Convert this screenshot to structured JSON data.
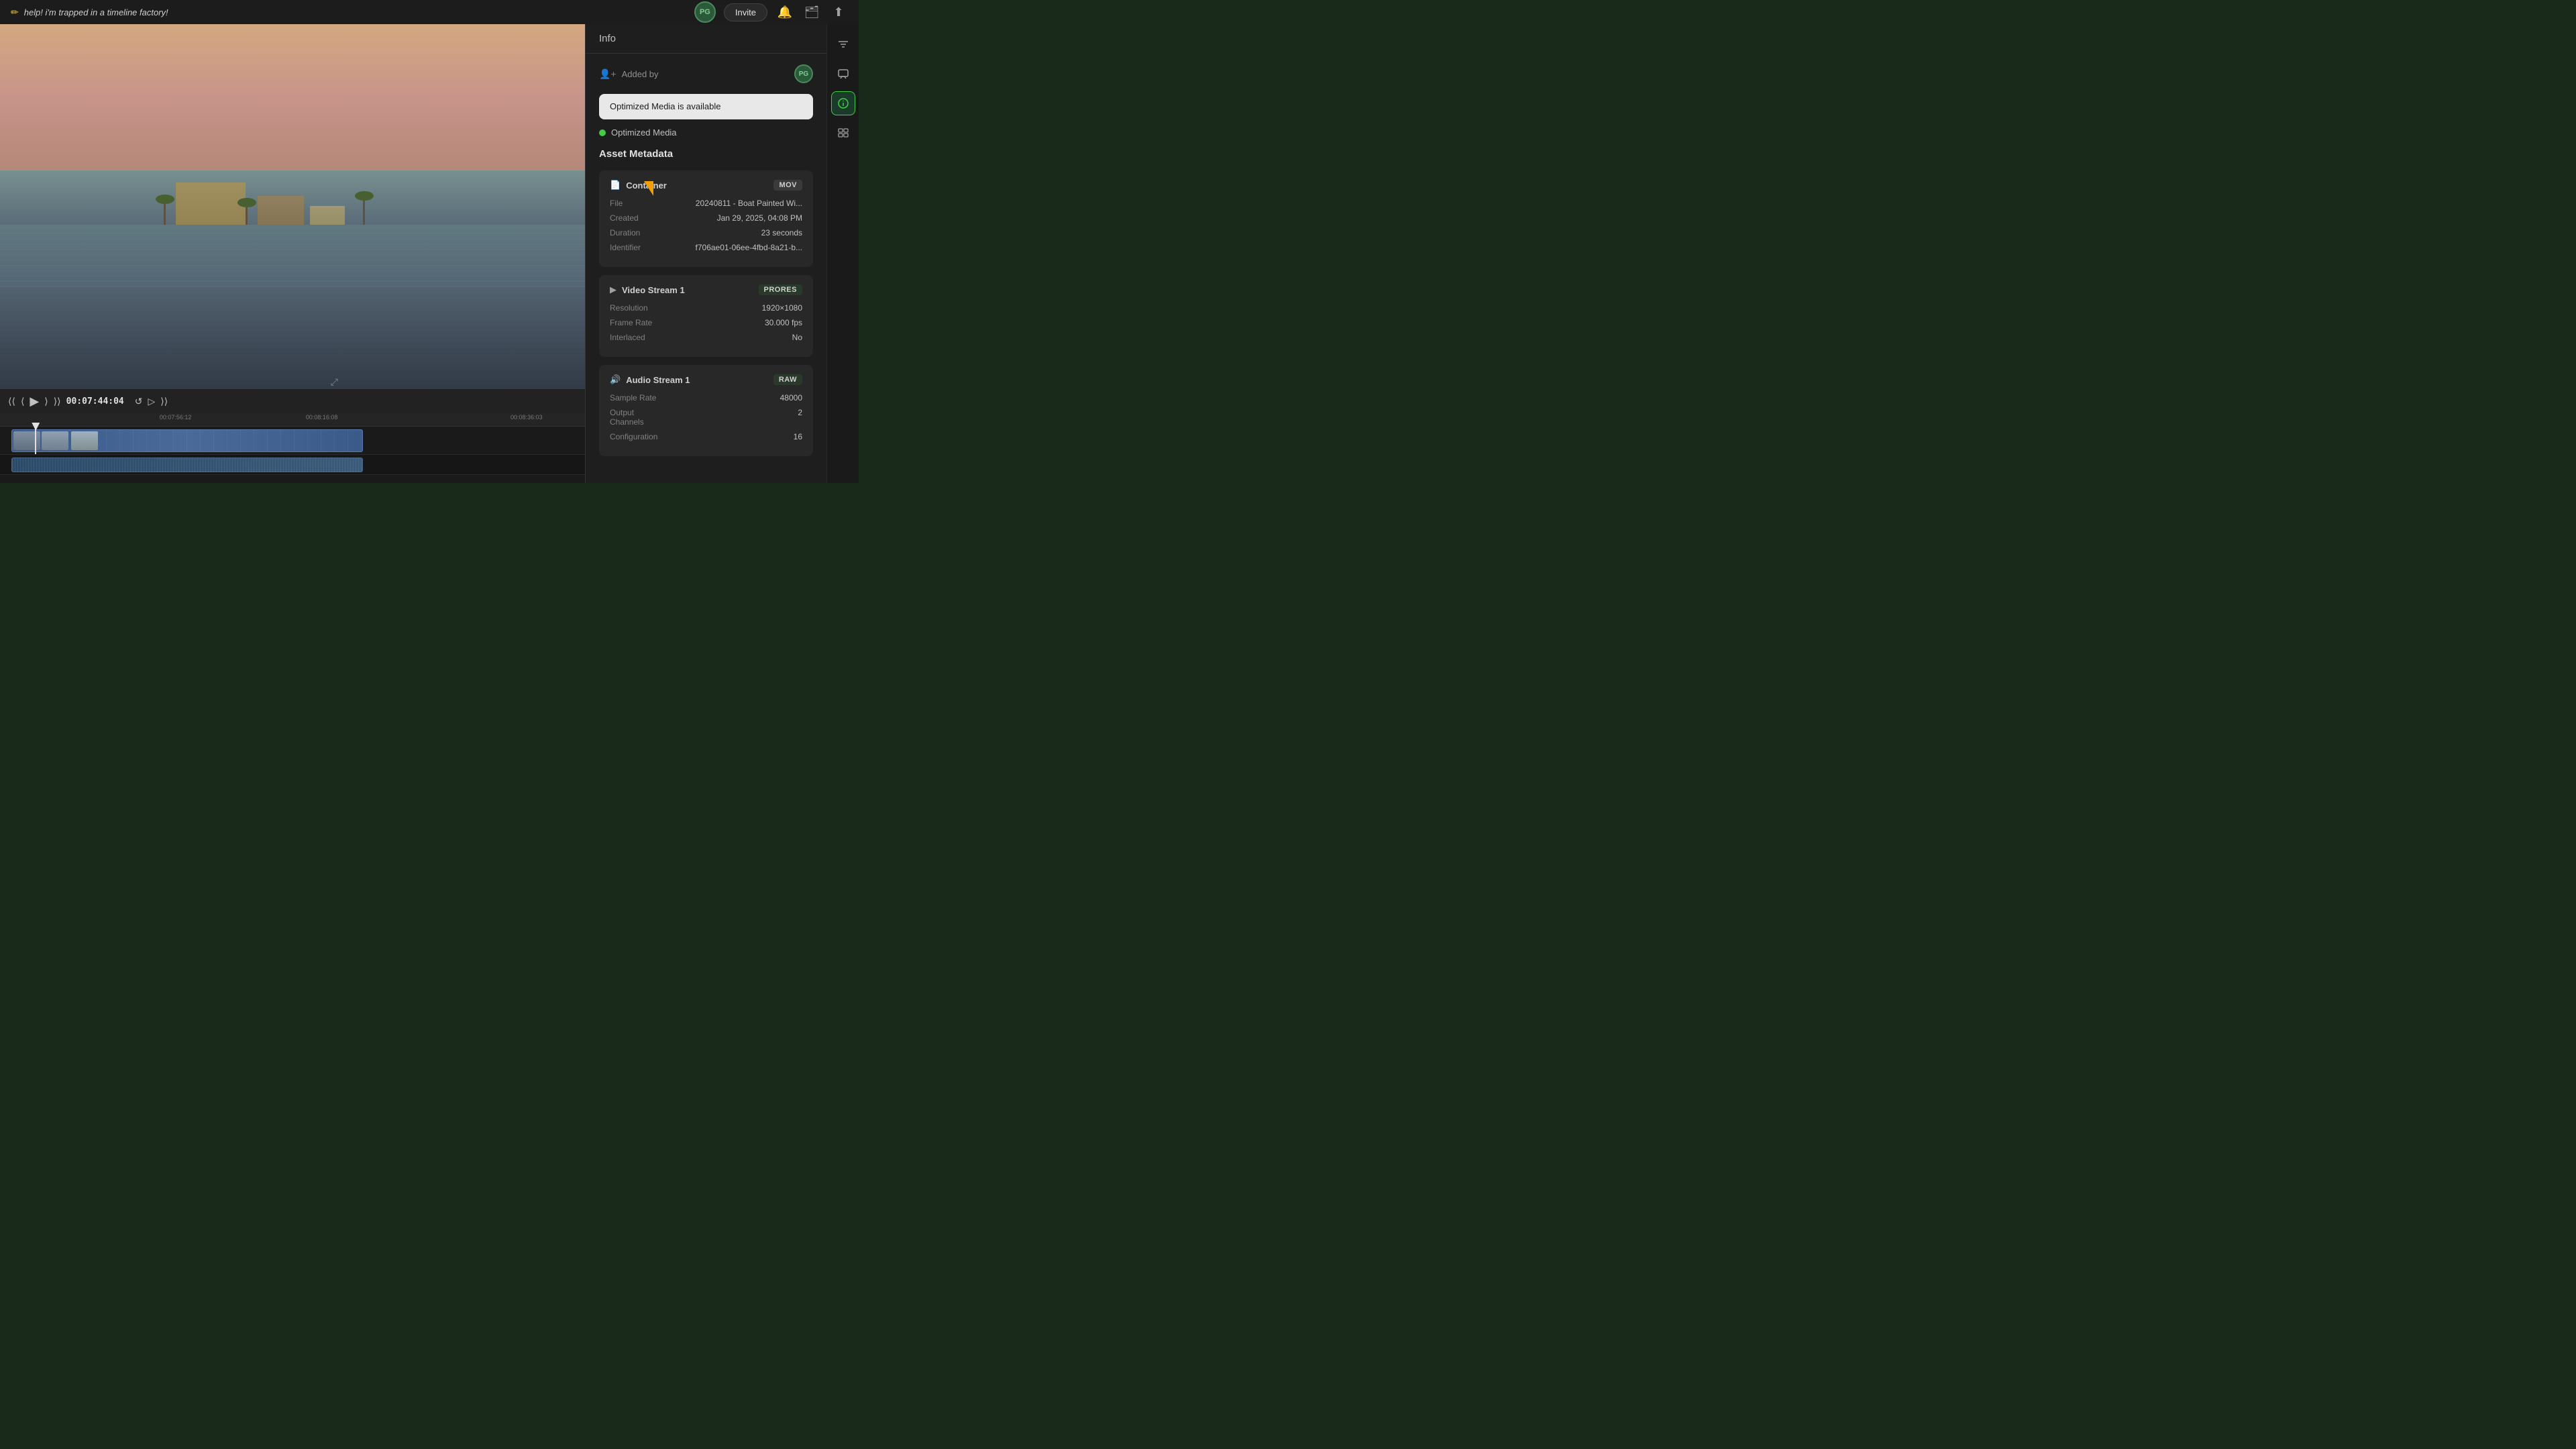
{
  "titleBar": {
    "icon": "✏",
    "title": "help! i'm trapped in a timeline factory!",
    "avatarLabel": "PG",
    "inviteLabel": "Invite"
  },
  "toolbar": {
    "bellIcon": "🔔",
    "libraryIcon": "🗂",
    "exportIcon": "⬆"
  },
  "timeline": {
    "timecode": "00:07:44:04",
    "markerTime": "00:07:56:12",
    "endTime": "00:08:36:03",
    "midTime": "00:08:16:08",
    "controls": {
      "rewindLabel": "⟨⟨",
      "prevFrameLabel": "⟨",
      "playLabel": "▶",
      "nextFrameLabel": "⟩",
      "forwardLabel": "⟩⟩",
      "loopLabel": "↺",
      "forwardPlayLabel": "▷",
      "fastForwardLabel": "⟩⟩"
    }
  },
  "infoPanel": {
    "title": "Info",
    "addedByLabel": "Added by",
    "avatarLabel": "PG",
    "optimizedMediaTooltip": "Optimized Media is available",
    "optimizedMediaLabel": "Optimized Media",
    "assetMetadataLabel": "Asset Metadata",
    "container": {
      "sectionLabel": "Container",
      "badgeLabel": "MOV",
      "fileLabel": "File",
      "fileValue": "20240811 - Boat Painted Wi...",
      "createdLabel": "Created",
      "createdValue": "Jan 29, 2025, 04:08 PM",
      "durationLabel": "Duration",
      "durationValue": "23 seconds",
      "identifierLabel": "Identifier",
      "identifierValue": "f706ae01-06ee-4fbd-8a21-b..."
    },
    "videoStream": {
      "sectionLabel": "Video Stream 1",
      "badgeLabel": "PRORES",
      "resolutionLabel": "Resolution",
      "resolutionValue": "1920×1080",
      "frameRateLabel": "Frame Rate",
      "frameRateValue": "30.000 fps",
      "interlacedLabel": "Interlaced",
      "interlacedValue": "No"
    },
    "audioStream": {
      "sectionLabel": "Audio Stream 1",
      "badgeLabel": "RAW",
      "sampleRateLabel": "Sample Rate",
      "sampleRateValue": "48000",
      "outputChannelsLabel": "Output Channels",
      "outputChannelsValue": "2",
      "configurationLabel": "Configuration",
      "configurationValue": "16"
    }
  },
  "rightSidebar": {
    "filterIcon": "⚙",
    "chatIcon": "💬",
    "infoIcon": "ⓘ",
    "timelineIcon": "▦"
  }
}
